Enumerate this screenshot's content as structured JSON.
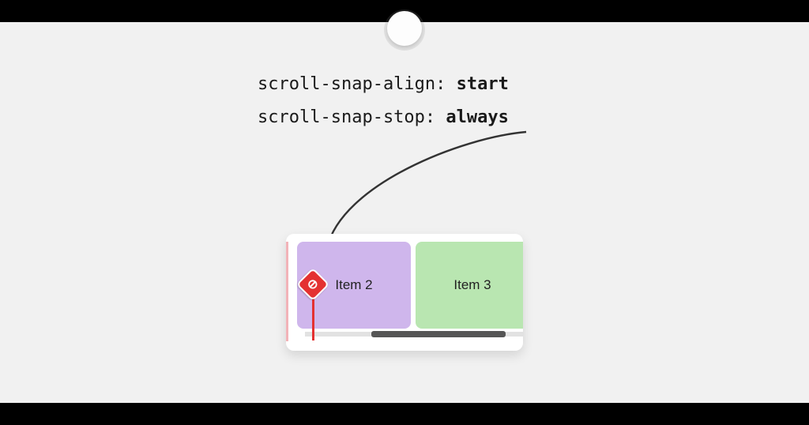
{
  "code": {
    "line1_prop": "scroll-snap-align:",
    "line1_val": "start",
    "line2_prop": "scroll-snap-stop:",
    "line2_val": "always"
  },
  "items": {
    "item2": "Item 2",
    "item3": "Item 3"
  }
}
